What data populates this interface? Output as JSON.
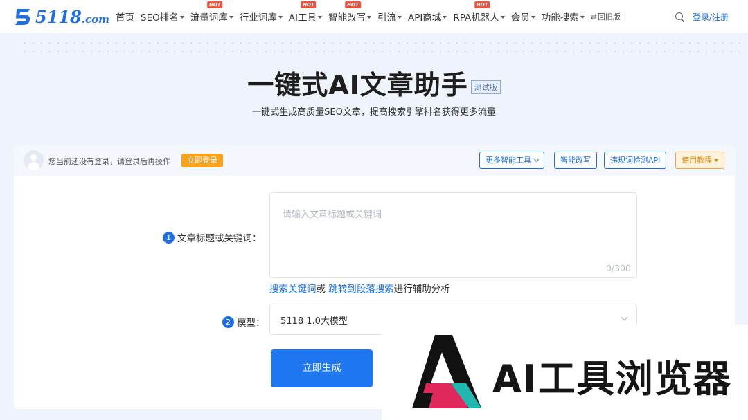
{
  "header": {
    "logo_text": "5118",
    "logo_suffix": ".com",
    "nav": [
      {
        "label": "首页",
        "caret": false,
        "hot": false
      },
      {
        "label": "SEO排名",
        "caret": true,
        "hot": false
      },
      {
        "label": "流量词库",
        "caret": true,
        "hot": true
      },
      {
        "label": "行业词库",
        "caret": true,
        "hot": false
      },
      {
        "label": "AI工具",
        "caret": true,
        "hot": true
      },
      {
        "label": "智能改写",
        "caret": true,
        "hot": true
      },
      {
        "label": "引流",
        "caret": true,
        "hot": false
      },
      {
        "label": "API商城",
        "caret": true,
        "hot": false
      },
      {
        "label": "RPA机器人",
        "caret": true,
        "hot": true
      },
      {
        "label": "会员",
        "caret": true,
        "hot": false
      },
      {
        "label": "功能搜索",
        "caret": true,
        "hot": false
      }
    ],
    "hot_badge": "HOT",
    "back_old": "回旧版",
    "login_register": "登录/注册"
  },
  "hero": {
    "title": "一键式AI文章助手",
    "badge": "测试版",
    "subtitle": "一键式生成高质量SEO文章，提高搜索引擎排名获得更多流量"
  },
  "card": {
    "login_tip": "您当前还没有登录，请登录后再操作",
    "login_button": "立即登录",
    "tools": {
      "more_tools": "更多智能工具",
      "smart_rewrite": "智能改写",
      "violation_check": "违规词检测API",
      "tutorial": "使用教程"
    },
    "step1": {
      "num": "1",
      "label": "文章标题或关键词："
    },
    "title_input": {
      "placeholder": "请输入文章标题或关键词",
      "count": "0/300"
    },
    "hint": {
      "link1": "搜索关键词",
      "or": "或 ",
      "link2": "跳转到段落搜索",
      "tail": "进行辅助分析"
    },
    "step2": {
      "num": "2",
      "label": "模型："
    },
    "model_select": {
      "value": "5118 1.0大模型"
    },
    "generate_button": "立即生成"
  },
  "watermark": {
    "text": "AI工具浏览器"
  },
  "colors": {
    "brand_blue": "#1f6fe3",
    "orange": "#f9a21b",
    "hot_red": "#f0543e"
  }
}
